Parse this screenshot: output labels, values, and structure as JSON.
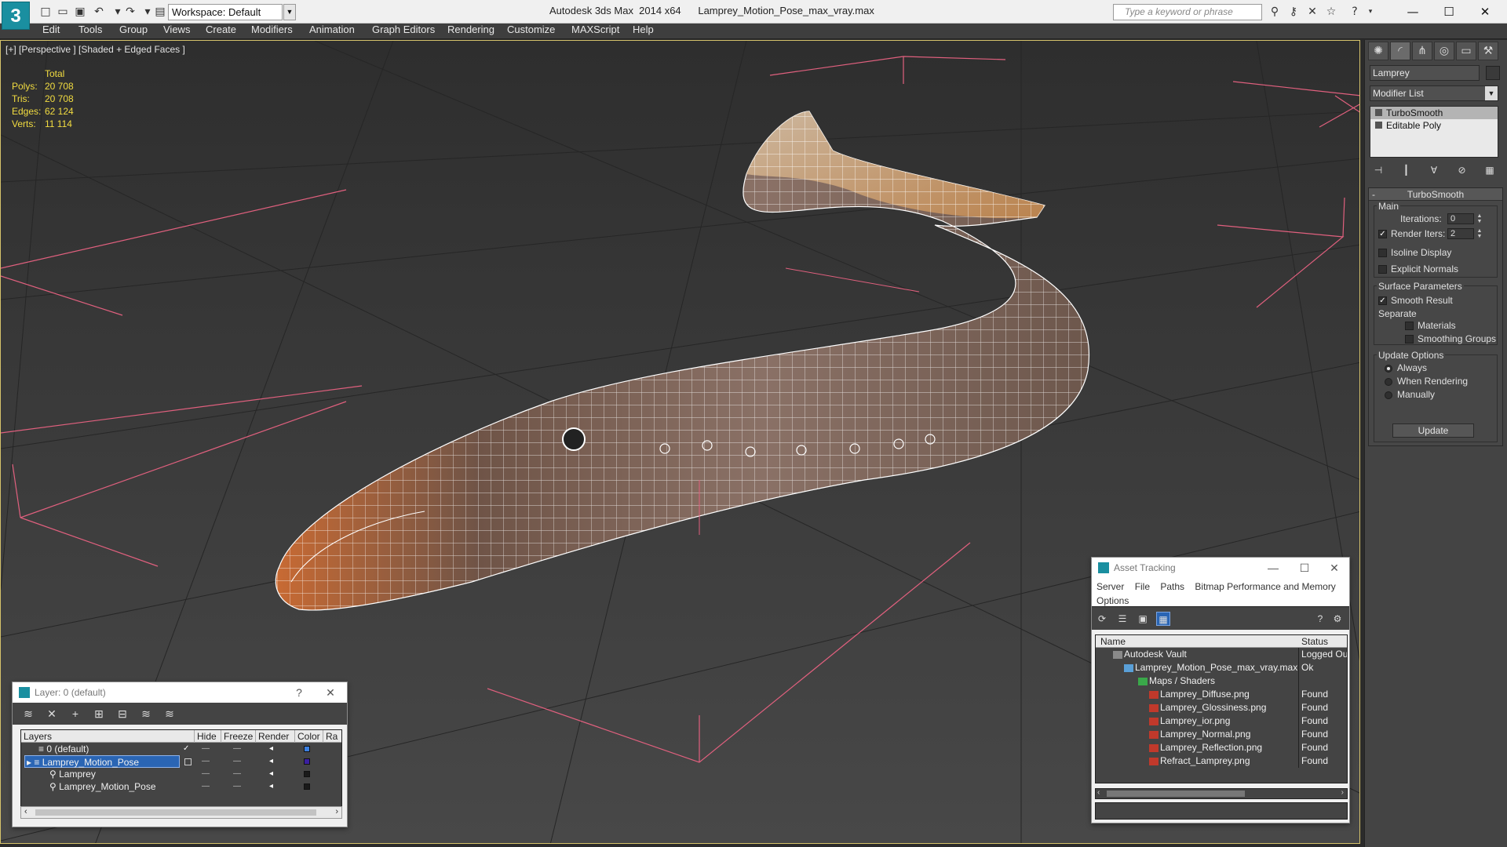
{
  "title_bar": {
    "app_title": "Autodesk 3ds Max  2014 x64",
    "file_name": "Lamprey_Motion_Pose_max_vray.max",
    "workspace": "Workspace: Default",
    "search_placeholder": "Type a keyword or phrase",
    "logo_glyph": "3"
  },
  "menu": [
    "Edit",
    "Tools",
    "Group",
    "Views",
    "Create",
    "Modifiers",
    "Animation",
    "Graph Editors",
    "Rendering",
    "Customize",
    "MAXScript",
    "Help"
  ],
  "viewport": {
    "label": "[+] [Perspective ] [Shaded + Edged Faces ]",
    "stats_header": "Total",
    "stats": [
      {
        "label": "Polys:",
        "value": "20 708"
      },
      {
        "label": "Tris:",
        "value": "20 708"
      },
      {
        "label": "Edges:",
        "value": "62 124"
      },
      {
        "label": "Verts:",
        "value": "11 114"
      }
    ],
    "stats_color": "#f2dc40",
    "gizmo_color": "#e0607e"
  },
  "command_panel": {
    "object_name": "Lamprey",
    "modifier_list": "Modifier List",
    "stack": [
      "TurboSmooth",
      "Editable Poly"
    ],
    "rollout_title": "TurboSmooth",
    "main_group": "Main",
    "iterations_label": "Iterations:",
    "iterations_value": "0",
    "render_iters_label": "Render Iters:",
    "render_iters_value": "2",
    "render_iters_checked": true,
    "isoline_label": "Isoline Display",
    "explicit_normals_label": "Explicit Normals",
    "surface_group": "Surface Parameters",
    "smooth_result_label": "Smooth Result",
    "separate_label": "Separate",
    "materials_label": "Materials",
    "smoothing_groups_label": "Smoothing Groups",
    "update_group": "Update Options",
    "always_label": "Always",
    "when_rendering_label": "When Rendering",
    "manually_label": "Manually",
    "update_button": "Update"
  },
  "asset_tracking": {
    "title": "Asset Tracking",
    "menu": [
      "Server",
      "File",
      "Paths",
      "Bitmap Performance and Memory",
      "Options"
    ],
    "columns": [
      "Name",
      "Status"
    ],
    "rows": [
      {
        "name": "Autodesk Vault",
        "status": "Logged Out",
        "indent": 0
      },
      {
        "name": "Lamprey_Motion_Pose_max_vray.max",
        "status": "Ok",
        "indent": 1
      },
      {
        "name": "Maps / Shaders",
        "status": "",
        "indent": 2
      },
      {
        "name": "Lamprey_Diffuse.png",
        "status": "Found",
        "indent": 3
      },
      {
        "name": "Lamprey_Glossiness.png",
        "status": "Found",
        "indent": 3
      },
      {
        "name": "Lamprey_ior.png",
        "status": "Found",
        "indent": 3
      },
      {
        "name": "Lamprey_Normal.png",
        "status": "Found",
        "indent": 3
      },
      {
        "name": "Lamprey_Reflection.png",
        "status": "Found",
        "indent": 3
      },
      {
        "name": "Refract_Lamprey.png",
        "status": "Found",
        "indent": 3
      }
    ]
  },
  "layer_manager": {
    "title": "Layer: 0 (default)",
    "columns": [
      "Layers",
      "Hide",
      "Freeze",
      "Render",
      "Color",
      "Ra"
    ],
    "rows": [
      {
        "name": "0 (default)",
        "color": "#3b7fe0"
      },
      {
        "name": "Lamprey_Motion_Pose",
        "color": "#3a1fa0"
      },
      {
        "name": "Lamprey",
        "color": "#1a1a1a"
      },
      {
        "name": "Lamprey_Motion_Pose",
        "color": "#1a1a1a"
      }
    ]
  }
}
